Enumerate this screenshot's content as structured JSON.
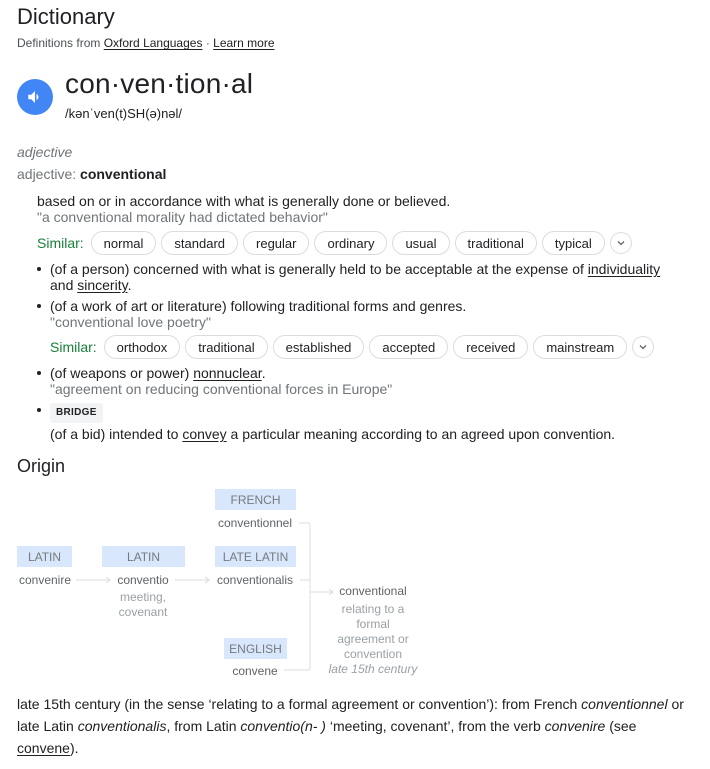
{
  "header": {
    "title": "Dictionary",
    "source_prefix": "Definitions from",
    "source_link": "Oxford Languages",
    "separator": "·",
    "learn_more": "Learn more"
  },
  "entry": {
    "headword": "con·ven·tion·al",
    "phonetic": "/kənˈven(t)SH(ə)nəl/",
    "speaker_icon": "speaker-icon",
    "pos_italic": "adjective",
    "pos_label": "adjective:",
    "pos_word": "conventional"
  },
  "senses": {
    "main": {
      "definition": "based on or in accordance with what is generally done or believed.",
      "example": "\"a conventional morality had dictated behavior\"",
      "similar_label": "Similar:",
      "similar": [
        "normal",
        "standard",
        "regular",
        "ordinary",
        "usual",
        "traditional",
        "typical"
      ]
    },
    "sub": [
      {
        "pre": "(of a person) concerned with what is generally held to be acceptable at the expense of ",
        "link1": "individuality",
        "mid": " and ",
        "link2": "sincerity",
        "post": "."
      },
      {
        "definition": "(of a work of art or literature) following traditional forms and genres.",
        "example": "\"conventional love poetry\"",
        "similar_label": "Similar:",
        "similar": [
          "orthodox",
          "traditional",
          "established",
          "accepted",
          "received",
          "mainstream"
        ]
      },
      {
        "pre": "(of weapons or power) ",
        "link": "nonnuclear",
        "post": ".",
        "example": "\"agreement on reducing conventional forces in Europe\""
      },
      {
        "badge": "BRIDGE",
        "pre": "(of a bid) intended to ",
        "link": "convey",
        "post": " a particular meaning according to an agreed upon convention."
      }
    ]
  },
  "origin": {
    "title": "Origin",
    "diagram": {
      "nodes": [
        {
          "lang": "LATIN",
          "word": "convenire"
        },
        {
          "lang": "LATIN",
          "word": "conventio",
          "gloss1": "meeting,",
          "gloss2": "covenant"
        },
        {
          "lang": "FRENCH",
          "word": "conventionnel"
        },
        {
          "lang": "LATE LATIN",
          "word": "conventionalis"
        },
        {
          "lang": "ENGLISH",
          "word": "convene"
        },
        {
          "word": "conventional",
          "gloss1": "relating to a",
          "gloss2": "formal",
          "gloss3": "agreement or",
          "gloss4": "convention",
          "date": "late 15th century"
        }
      ]
    },
    "text": {
      "p1": "late 15th century (in the sense ‘relating to a formal agreement or convention’): from French ",
      "i1": "conventionnel",
      "p2": " or late Latin ",
      "i2": "conventionalis",
      "p3": ", from Latin ",
      "i3": "conventio(n- )",
      "p4": " ‘meeting, covenant’, from the verb ",
      "i4": "convenire",
      "p5": " (see ",
      "link": "convene",
      "p6": ")."
    }
  }
}
